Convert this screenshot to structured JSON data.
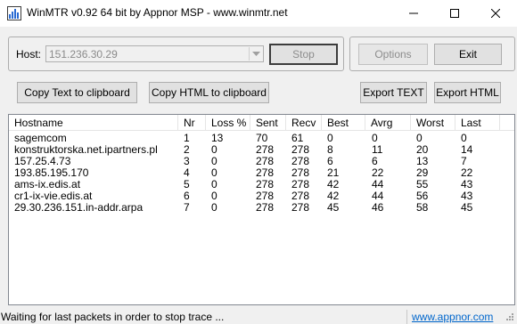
{
  "window": {
    "title": "WinMTR v0.92 64 bit by Appnor MSP - www.winmtr.net",
    "icon": "winmtr-app-icon",
    "controls": [
      "minimize-icon",
      "maximize-icon",
      "close-icon"
    ]
  },
  "host_group": {
    "host_label": "Host:",
    "host_value": "151.236.30.29",
    "stop_label": "Stop"
  },
  "right_group": {
    "options_label": "Options",
    "exit_label": "Exit"
  },
  "toolbar": {
    "copy_text_label": "Copy Text to clipboard",
    "copy_html_label": "Copy HTML to clipboard",
    "export_text_label": "Export TEXT",
    "export_html_label": "Export HTML"
  },
  "table": {
    "columns": [
      "Hostname",
      "Nr",
      "Loss %",
      "Sent",
      "Recv",
      "Best",
      "Avrg",
      "Worst",
      "Last"
    ],
    "rows": [
      [
        "sagemcom",
        "1",
        "13",
        "70",
        "61",
        "0",
        "0",
        "0",
        "0"
      ],
      [
        "konstruktorska.net.ipartners.pl",
        "2",
        "0",
        "278",
        "278",
        "8",
        "11",
        "20",
        "14"
      ],
      [
        "157.25.4.73",
        "3",
        "0",
        "278",
        "278",
        "6",
        "6",
        "13",
        "7"
      ],
      [
        "193.85.195.170",
        "4",
        "0",
        "278",
        "278",
        "21",
        "22",
        "29",
        "22"
      ],
      [
        "ams-ix.edis.at",
        "5",
        "0",
        "278",
        "278",
        "42",
        "44",
        "55",
        "43"
      ],
      [
        "cr1-ix-vie.edis.at",
        "6",
        "0",
        "278",
        "278",
        "42",
        "44",
        "56",
        "43"
      ],
      [
        "29.30.236.151.in-addr.arpa",
        "7",
        "0",
        "278",
        "278",
        "45",
        "46",
        "58",
        "45"
      ]
    ]
  },
  "statusbar": {
    "message": "Waiting for last packets in order to stop trace ...",
    "link": "www.appnor.com"
  },
  "colors": {
    "window_bg": "#f0f0f0",
    "link": "#0066cc",
    "border": "#adadad"
  }
}
